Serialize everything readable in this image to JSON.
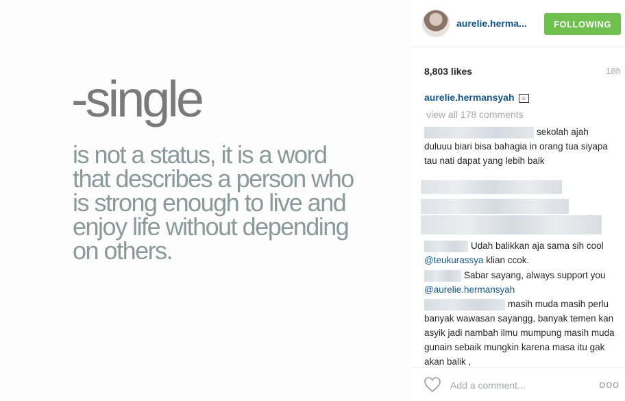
{
  "photo": {
    "title": "-single",
    "body": "is not a status, it is a word that describes a person who is strong enough to live and enjoy life without depending on others."
  },
  "header": {
    "username": "aurelie.herma...",
    "follow_label": "FOLLOWING"
  },
  "meta": {
    "likes": "8,803 likes",
    "time": "18h"
  },
  "caption": {
    "username": "aurelie.hermansyah",
    "emoji": "☺"
  },
  "view_all": "view all 178 comments",
  "comments": [
    {
      "text": "sekolah ajah duluuu biari bisa bahagia in orang tua siyapa tau nati dapat yang lebih baik"
    },
    {
      "text": "Udah balikkan aja sama sih cool",
      "mention": "@teukurassya",
      "after": " klian ccok."
    },
    {
      "text": "Sabar sayang, always support you",
      "mention": "@aurelie.hermansyah"
    },
    {
      "text": "masih muda masih perlu banyak wawasan sayangg, banyak temen kan asyik jadi nambah ilmu mumpung masih muda gunain sebaik mungkin karena masa itu gak akan balik ,"
    }
  ],
  "footer": {
    "add_comment_placeholder": "Add a comment...",
    "more": "ooo"
  },
  "colors": {
    "follow_green": "#70c050",
    "link_blue": "#125688"
  }
}
